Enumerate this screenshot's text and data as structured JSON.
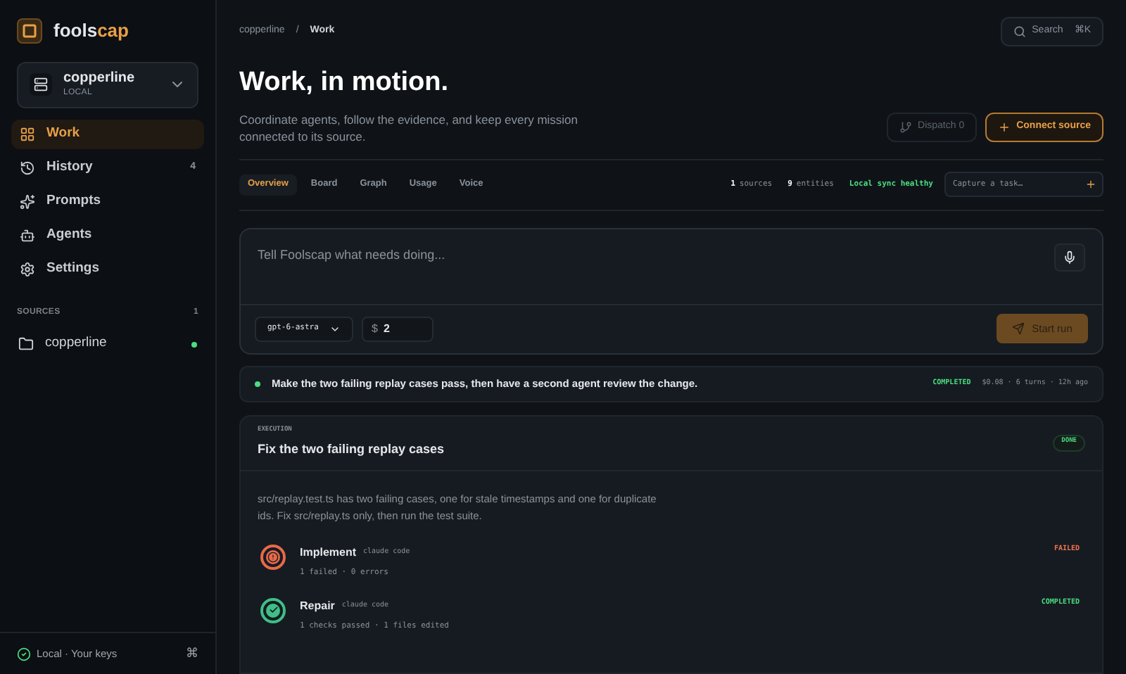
{
  "brand": {
    "name_main": "fools",
    "name_accent": "cap"
  },
  "workspace": {
    "name": "copperline",
    "subtitle": "LOCAL"
  },
  "nav": [
    {
      "label": "Work",
      "selected": true
    },
    {
      "label": "History",
      "selected": false,
      "count": "4"
    },
    {
      "label": "Prompts",
      "selected": false
    },
    {
      "label": "Agents",
      "selected": false
    },
    {
      "label": "Settings",
      "selected": false
    }
  ],
  "sources": {
    "title": "SOURCES",
    "count": "1",
    "items": [
      {
        "name": "copperline",
        "color": "#4ade80"
      }
    ]
  },
  "footer": {
    "status": "Local · Your keys",
    "shortcut": "⌘"
  },
  "breadcrumb": [
    "copperline",
    "Work"
  ],
  "breadcrumb_separator": "/",
  "search": {
    "label": "Search",
    "shortcut": "⌘K"
  },
  "header": {
    "title": "Work, in motion.",
    "subtitle": "Coordinate agents, follow the evidence, and keep every mission connected to its source."
  },
  "actions": {
    "dispatch": {
      "label": "Dispatch 0",
      "disabled": true
    },
    "connect": {
      "label": "Connect source"
    }
  },
  "tabs": [
    {
      "label": "Overview",
      "selected": true
    },
    {
      "label": "Board",
      "selected": false
    },
    {
      "label": "Graph",
      "selected": false
    },
    {
      "label": "Usage",
      "selected": false
    },
    {
      "label": "Voice",
      "selected": false
    }
  ],
  "stats": [
    {
      "value": "1",
      "label": "sources"
    },
    {
      "value": "9",
      "label": "entities"
    }
  ],
  "sync": "Local sync healthy",
  "capture": {
    "placeholder": "Capture a task…"
  },
  "composer": {
    "placeholder": "Tell Foolscap what needs doing...",
    "model": "gpt-6-astra",
    "budget_symbol": "$",
    "budget": "2",
    "submit": "Start run"
  },
  "run": {
    "text": "Make the two failing replay cases pass, then have a second agent review the change.",
    "status": "COMPLETED",
    "meta": "$0.08 · 6 turns · 12h ago"
  },
  "execution": {
    "eyebrow": "EXECUTION",
    "title": "Fix the two failing replay cases",
    "badge": "DONE",
    "description": "src/replay.test.ts has two failing cases, one for stale timestamps and one for duplicate ids. Fix src/replay.ts only, then run the test suite.",
    "steps": [
      {
        "name": "Implement",
        "agent": "claude code",
        "detail": "1 failed · 0 errors",
        "kind": "failed",
        "status_label": "FAILED"
      },
      {
        "name": "Repair",
        "agent": "claude code",
        "detail": "1 checks passed · 1 files edited",
        "kind": "completed",
        "status_label": "COMPLETED"
      }
    ]
  }
}
